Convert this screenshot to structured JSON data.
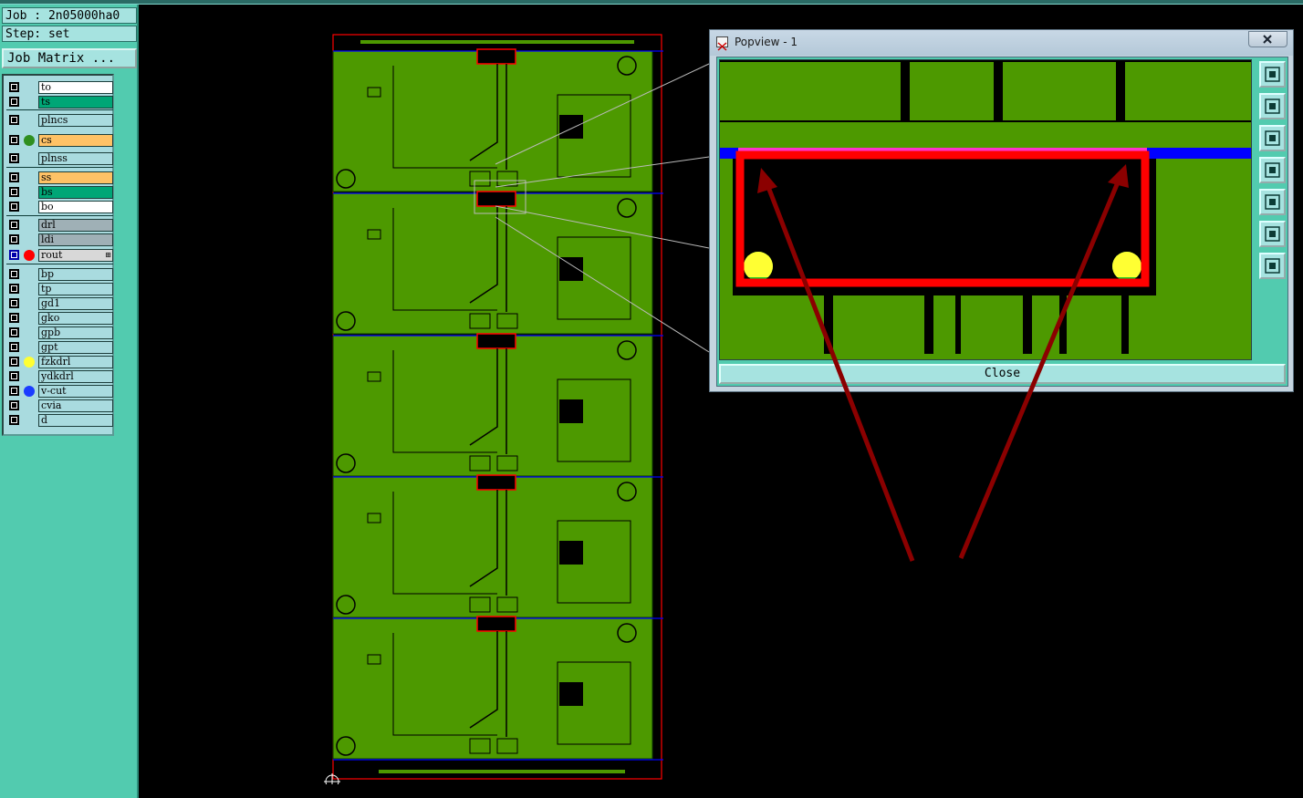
{
  "job": {
    "job_text": "Job : 2n05000ha0",
    "step_text": "Step: set",
    "matrix_label": "Job Matrix ..."
  },
  "layers": [
    {
      "name": "to",
      "bg": "#ffffff",
      "dot": null
    },
    {
      "name": "ts",
      "bg": "#00a676",
      "dot": null
    },
    {
      "name": "plncs",
      "bg": "#a9dbdf",
      "dot": null
    },
    {
      "name": "cs",
      "bg": "#ffc266",
      "dot": "#2f8f1f"
    },
    {
      "name": "plnss",
      "bg": "#a9dbdf",
      "dot": null
    },
    {
      "name": "ss",
      "bg": "#ffc266",
      "dot": null
    },
    {
      "name": "bs",
      "bg": "#00a676",
      "dot": null
    },
    {
      "name": "bo",
      "bg": "#ffffff",
      "dot": null
    },
    {
      "name": "drl",
      "bg": "#9fb0b6",
      "dot": null
    },
    {
      "name": "ldi",
      "bg": "#9fb0b6",
      "dot": null
    },
    {
      "name": "rout",
      "bg": "#d8d8d8",
      "dot": "#ff0000",
      "selected": true
    },
    {
      "name": "bp",
      "bg": "#a9dbdf",
      "dot": null
    },
    {
      "name": "tp",
      "bg": "#a9dbdf",
      "dot": null
    },
    {
      "name": "gd1",
      "bg": "#a9dbdf",
      "dot": null
    },
    {
      "name": "gko",
      "bg": "#a9dbdf",
      "dot": null
    },
    {
      "name": "gpb",
      "bg": "#a9dbdf",
      "dot": null
    },
    {
      "name": "gpt",
      "bg": "#a9dbdf",
      "dot": null
    },
    {
      "name": "fzkdrl",
      "bg": "#a9dbdf",
      "dot": "#ffff33"
    },
    {
      "name": "ydkdrl",
      "bg": "#a9dbdf",
      "dot": null
    },
    {
      "name": "v-cut",
      "bg": "#a9dbdf",
      "dot": "#1a3cff"
    },
    {
      "name": "cvia",
      "bg": "#a9dbdf",
      "dot": null
    },
    {
      "name": "d",
      "bg": "#a9dbdf",
      "dot": null
    }
  ],
  "popview": {
    "title": "Popview - 1",
    "close_label": "Close",
    "tools": [
      "zoom-home-icon",
      "zoom-in-icon",
      "zoom-out-icon",
      "pan-left-icon",
      "pan-right-icon",
      "fit-all-icon",
      "center-icon"
    ]
  },
  "colors": {
    "copper": "#4d9900",
    "rout": "#ff0000",
    "vcut": "#0000ff",
    "drill": "#ffff33",
    "arrow": "#8b0000",
    "panel": "#52cbaf"
  }
}
